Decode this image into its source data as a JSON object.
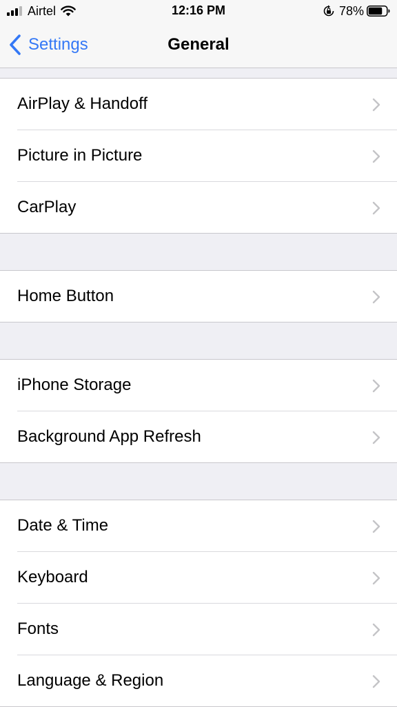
{
  "status_bar": {
    "carrier": "Airtel",
    "time": "12:16 PM",
    "battery_percent": "78%",
    "battery_level": 0.78,
    "signal_bars_total": 4,
    "signal_bars_filled": 3,
    "icons": [
      "signal-icon",
      "wifi-icon",
      "orientation-lock-icon",
      "battery-icon"
    ]
  },
  "nav": {
    "back_label": "Settings",
    "title": "General",
    "accent_color": "#3478f6"
  },
  "groups": [
    {
      "items": [
        {
          "label": "AirPlay & Handoff"
        },
        {
          "label": "Picture in Picture"
        },
        {
          "label": "CarPlay"
        }
      ]
    },
    {
      "items": [
        {
          "label": "Home Button"
        }
      ]
    },
    {
      "items": [
        {
          "label": "iPhone Storage"
        },
        {
          "label": "Background App Refresh"
        }
      ]
    },
    {
      "items": [
        {
          "label": "Date & Time"
        },
        {
          "label": "Keyboard"
        },
        {
          "label": "Fonts"
        },
        {
          "label": "Language & Region"
        }
      ]
    }
  ]
}
